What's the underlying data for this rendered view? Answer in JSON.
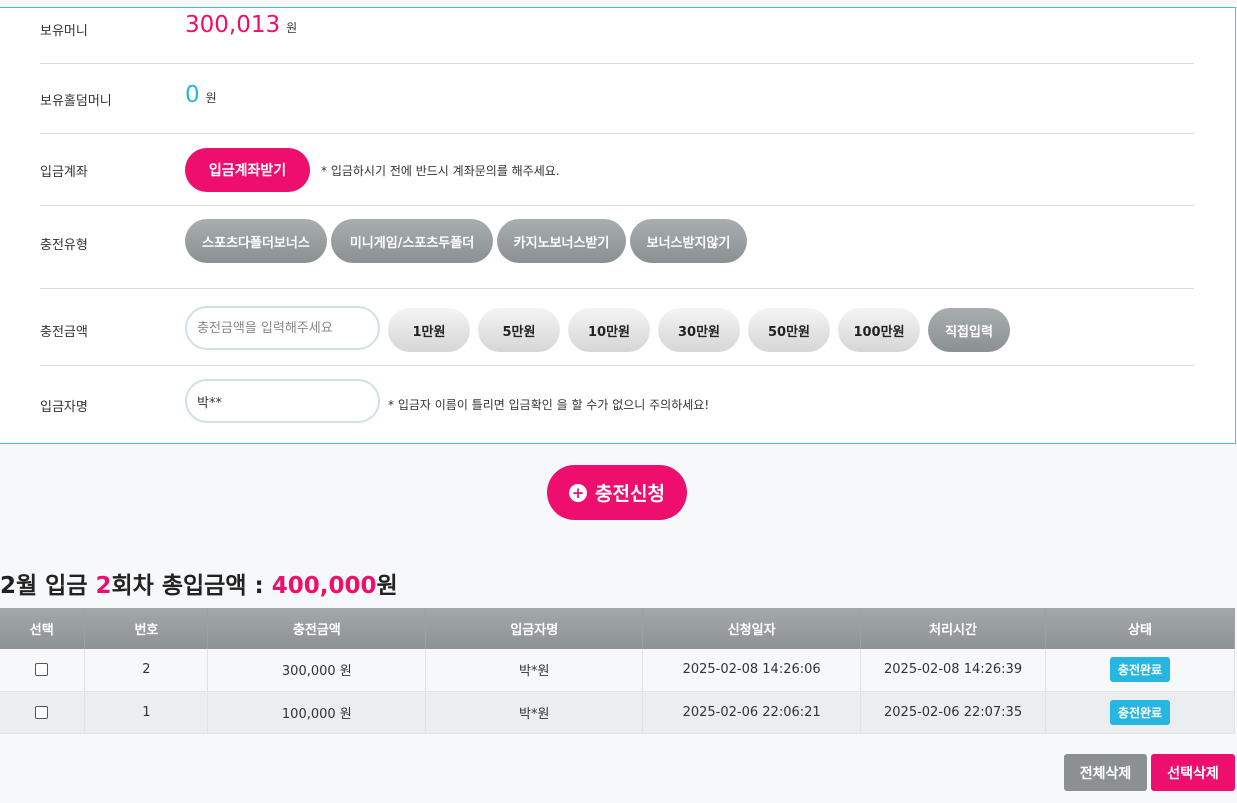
{
  "balance": {
    "label": "보유머니",
    "amount": "300,013",
    "unit": "원"
  },
  "holdem_balance": {
    "label": "보유홀덤머니",
    "amount": "0",
    "unit": "원"
  },
  "account": {
    "label": "입금계좌",
    "button": "입금계좌받기",
    "note": "* 입금하시기 전에 반드시 계좌문의를 해주세요."
  },
  "charge_type": {
    "label": "충전유형",
    "options": [
      "스포츠다폴더보너스",
      "미니게임/스포츠두폴더",
      "카지노보너스받기",
      "보너스받지않기"
    ]
  },
  "charge_amount": {
    "label": "충전금액",
    "placeholder": "충전금액을 입력해주세요",
    "options": [
      "1만원",
      "5만원",
      "10만원",
      "30만원",
      "50만원",
      "100만원"
    ],
    "manual": "직접입력"
  },
  "depositor": {
    "label": "입금자명",
    "value": "박**",
    "note": "* 입금자 이름이 틀리면 입금확인 을 할 수가 없으니 주의하세요!"
  },
  "submit": {
    "label": "충전신청"
  },
  "summary": {
    "prefix": "2월 입금 ",
    "count": "2",
    "middle": "회차 총입금액 : ",
    "total": "400,000",
    "suffix": "원"
  },
  "table": {
    "headers": [
      "선택",
      "번호",
      "충전금액",
      "입금자명",
      "신청일자",
      "처리시간",
      "상태"
    ],
    "rows": [
      {
        "no": "2",
        "amount": "300,000 원",
        "name": "박*원",
        "requested": "2025-02-08 14:26:06",
        "processed": "2025-02-08 14:26:39",
        "status": "충전완료"
      },
      {
        "no": "1",
        "amount": "100,000 원",
        "name": "박*원",
        "requested": "2025-02-06 22:06:21",
        "processed": "2025-02-06 22:07:35",
        "status": "충전완료"
      }
    ]
  },
  "actions": {
    "delete_all": "전체삭제",
    "delete_selected": "선택삭제"
  },
  "colors": {
    "accent": "#ee0e6d",
    "info": "#27b6df",
    "gray_button": "#8b9193"
  }
}
